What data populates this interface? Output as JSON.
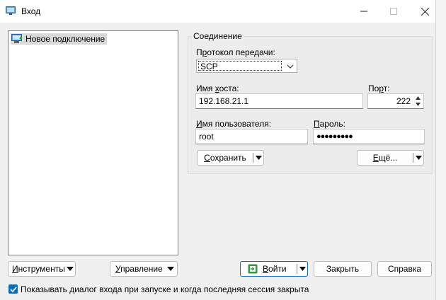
{
  "window": {
    "title": "Вход"
  },
  "sites": [
    {
      "label": "Новое подключение"
    }
  ],
  "connection": {
    "group_label": "Соединение",
    "protocol_label_pre": "П",
    "protocol_label_u": "р",
    "protocol_label_post": "отокол передачи:",
    "protocol_value": "SCP",
    "host_label_pre": "Имя ",
    "host_label_u": "х",
    "host_label_post": "оста:",
    "host_value": "192.168.21.1",
    "port_label_pre": "По",
    "port_label_u": "р",
    "port_label_post": "т:",
    "port_value": "222",
    "user_label_pre": "",
    "user_label_u": "И",
    "user_label_post": "мя пользователя:",
    "user_value": "root",
    "password_label_pre": "",
    "password_label_u": "П",
    "password_label_post": "ароль:",
    "password_value": "●●●●●●●●●",
    "save_pre": "",
    "save_u": "С",
    "save_post": "охранить",
    "more_pre": "",
    "more_u": "Е",
    "more_post": "щё..."
  },
  "footer": {
    "tools_pre": "",
    "tools_u": "И",
    "tools_post": "нструменты",
    "manage_pre": "",
    "manage_u": "У",
    "manage_post": "правление",
    "login_pre": "",
    "login_u": "В",
    "login_post": "ойти",
    "close_label": "Закрыть",
    "help_label": "Справка",
    "show_dialog_label": "Показывать диалог входа при запуске и когда последняя сессия закрыта",
    "show_dialog_checked": true
  },
  "colors": {
    "accent": "#0f6cbd",
    "login_icon": "#2e9c3a"
  }
}
